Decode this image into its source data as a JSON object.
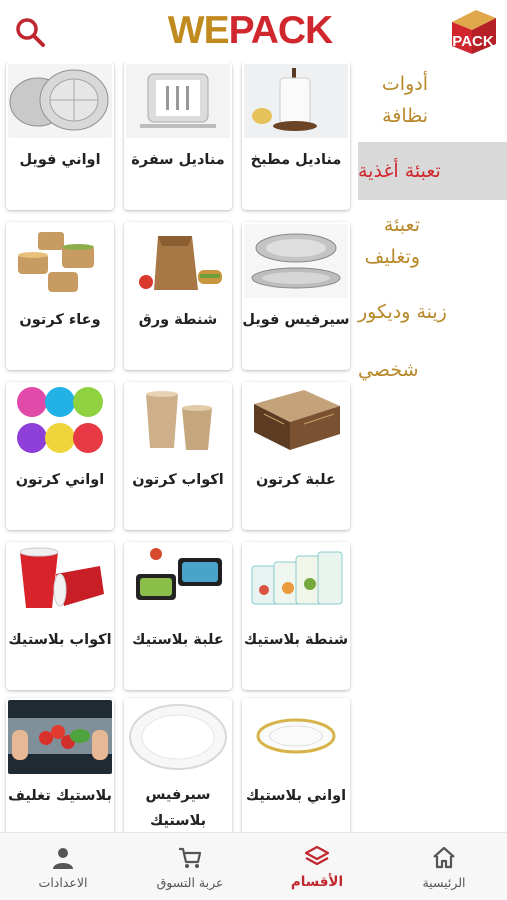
{
  "header": {
    "brand_we": "WE",
    "brand_pack": "PACK",
    "logo_text": "PACK"
  },
  "sidebar": {
    "items": [
      {
        "label": "أدوات نظافة",
        "active": false
      },
      {
        "label": "تعبئة أغذية",
        "active": true
      },
      {
        "label": "تعبئة وتغليف",
        "active": false
      },
      {
        "label": "زينة وديكور",
        "active": false
      },
      {
        "label": "شخصي",
        "active": false
      }
    ]
  },
  "products": [
    {
      "label": "مناديل مطبخ",
      "icon": "paper-towel-icon"
    },
    {
      "label": "مناديل سفرة",
      "icon": "napkin-holder-icon"
    },
    {
      "label": "اواني فويل",
      "icon": "foil-plate-icon"
    },
    {
      "label": "سيرفيس فويل",
      "icon": "foil-tray-icon"
    },
    {
      "label": "شنطة ورق",
      "icon": "paper-bag-icon"
    },
    {
      "label": "وعاء كرتون",
      "icon": "paper-bowl-icon"
    },
    {
      "label": "علبة كرتون",
      "icon": "carton-box-icon"
    },
    {
      "label": "اكواب كرتون",
      "icon": "paper-cup-icon"
    },
    {
      "label": "اواني كرتون",
      "icon": "paper-plate-icon"
    },
    {
      "label": "شنطة بلاستيك",
      "icon": "zip-bag-icon"
    },
    {
      "label": "علبة بلاستيك",
      "icon": "plastic-box-icon"
    },
    {
      "label": "اكواب بلاستيك",
      "icon": "plastic-cup-icon"
    },
    {
      "label": "اواني بلاستيك",
      "icon": "plastic-plate-icon"
    },
    {
      "label": "سيرفيس بلاستيك",
      "icon": "plastic-platter-icon"
    },
    {
      "label": "بلاستيك تغليف",
      "icon": "cling-wrap-icon"
    }
  ],
  "bottom_nav": [
    {
      "label": "الرئيسية",
      "icon": "home-icon",
      "active": false
    },
    {
      "label": "الأقسام",
      "icon": "layers-icon",
      "active": true
    },
    {
      "label": "عربة التسوق",
      "icon": "cart-icon",
      "active": false
    },
    {
      "label": "الاعدادات",
      "icon": "user-icon",
      "active": false
    }
  ],
  "colors": {
    "accent_gold": "#b8892a",
    "accent_red": "#cf2a2f",
    "active_bg": "#d9d9d9"
  }
}
